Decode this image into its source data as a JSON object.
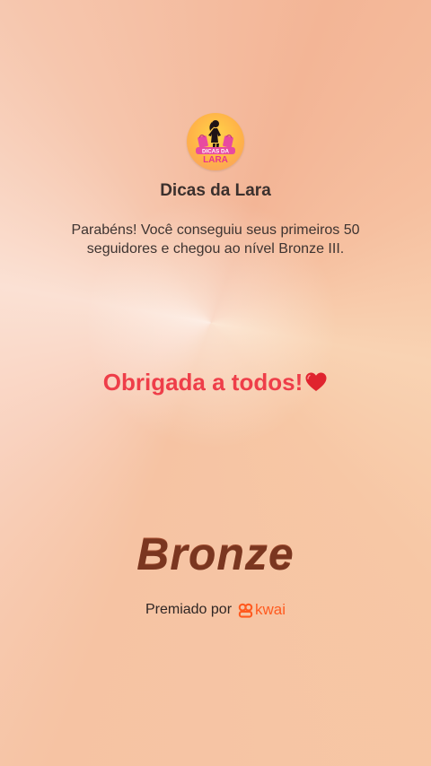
{
  "profile": {
    "avatar_icon": "dicas-da-lara-logo-icon",
    "avatar_text_top": "DICAS DA",
    "avatar_text_bottom": "LARA",
    "name": "Dicas da Lara"
  },
  "achievement": {
    "message": "Parabéns! Você conseguiu seus primeiros 50 seguidores e chegou ao nível Bronze III.",
    "thanks": "Obrigada a todos!",
    "thanks_icon": "red-heart-icon",
    "level": "Bronze"
  },
  "footer": {
    "awarded_by": "Premiado por",
    "brand": "kwai",
    "brand_icon": "kwai-logo-icon",
    "brand_color": "#ff5a1f"
  },
  "colors": {
    "thanks_text": "#ee3e49",
    "level_text": "#9a4a2e"
  }
}
